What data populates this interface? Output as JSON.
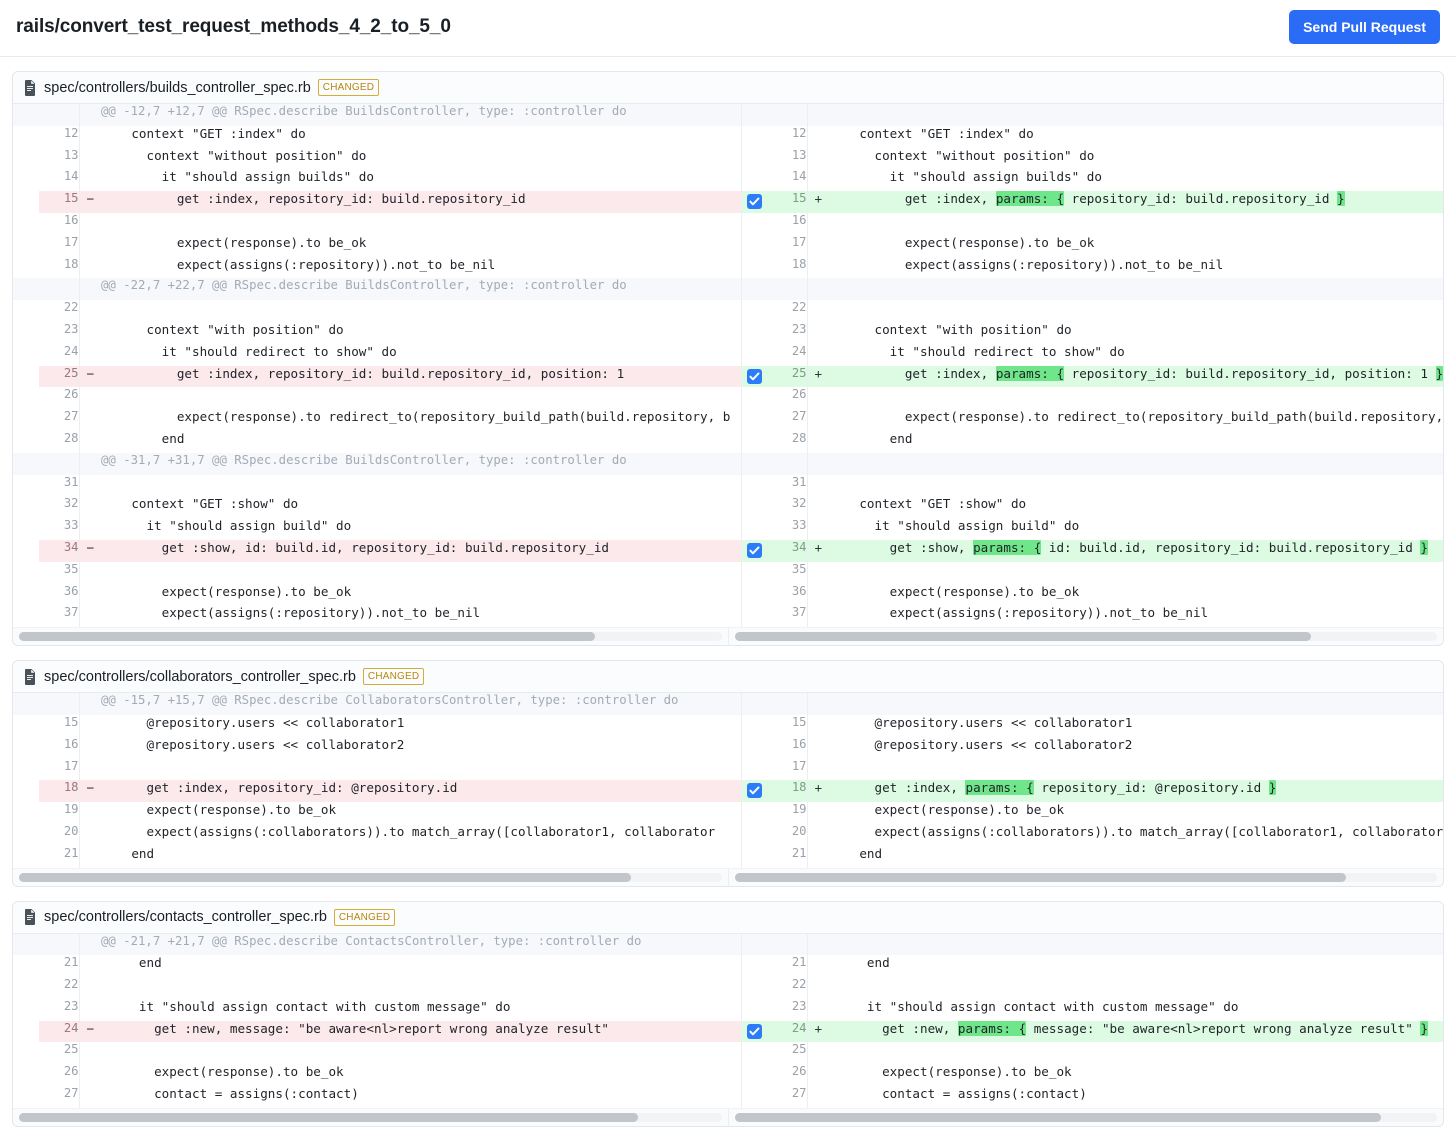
{
  "header": {
    "branch_title": "rails/convert_test_request_methods_4_2_to_5_0",
    "send_pr_label": "Send Pull Request"
  },
  "badge_label": "CHANGED",
  "files": [
    {
      "path": "spec/controllers/builds_controller_spec.rb",
      "left_scroll_pct": 82,
      "right_scroll_pct": 82,
      "rows": [
        {
          "type": "hunk",
          "left_num": "",
          "right_num": "",
          "left_text": "@@ -12,7 +12,7 @@ RSpec.describe BuildsController, type: :controller do",
          "right_text": ""
        },
        {
          "type": "ctx",
          "left_num": "12",
          "right_num": "12",
          "left_text": "    context \"GET :index\" do",
          "right_text": "    context \"GET :index\" do"
        },
        {
          "type": "ctx",
          "left_num": "13",
          "right_num": "13",
          "left_text": "      context \"without position\" do",
          "right_text": "      context \"without position\" do"
        },
        {
          "type": "ctx",
          "left_num": "14",
          "right_num": "14",
          "left_text": "        it \"should assign builds\" do",
          "right_text": "        it \"should assign builds\" do"
        },
        {
          "type": "change",
          "left_num": "15",
          "right_num": "15",
          "checked": true,
          "left_text": "          get :index, repository_id: build.repository_id",
          "right_parts": [
            {
              "t": "          get :index, ",
              "hl": false
            },
            {
              "t": "params: {",
              "hl": true
            },
            {
              "t": " repository_id: build.repository_id ",
              "hl": false
            },
            {
              "t": "}",
              "hl": true
            }
          ]
        },
        {
          "type": "ctx",
          "left_num": "16",
          "right_num": "16",
          "left_text": "",
          "right_text": ""
        },
        {
          "type": "ctx",
          "left_num": "17",
          "right_num": "17",
          "left_text": "          expect(response).to be_ok",
          "right_text": "          expect(response).to be_ok"
        },
        {
          "type": "ctx",
          "left_num": "18",
          "right_num": "18",
          "left_text": "          expect(assigns(:repository)).not_to be_nil",
          "right_text": "          expect(assigns(:repository)).not_to be_nil"
        },
        {
          "type": "hunk",
          "left_num": "",
          "right_num": "",
          "left_text": "@@ -22,7 +22,7 @@ RSpec.describe BuildsController, type: :controller do",
          "right_text": ""
        },
        {
          "type": "ctx",
          "left_num": "22",
          "right_num": "22",
          "left_text": "",
          "right_text": ""
        },
        {
          "type": "ctx",
          "left_num": "23",
          "right_num": "23",
          "left_text": "      context \"with position\" do",
          "right_text": "      context \"with position\" do"
        },
        {
          "type": "ctx",
          "left_num": "24",
          "right_num": "24",
          "left_text": "        it \"should redirect to show\" do",
          "right_text": "        it \"should redirect to show\" do"
        },
        {
          "type": "change",
          "left_num": "25",
          "right_num": "25",
          "checked": true,
          "left_text": "          get :index, repository_id: build.repository_id, position: 1",
          "right_parts": [
            {
              "t": "          get :index, ",
              "hl": false
            },
            {
              "t": "params: {",
              "hl": true
            },
            {
              "t": " repository_id: build.repository_id, position: 1 ",
              "hl": false
            },
            {
              "t": "}",
              "hl": true
            }
          ]
        },
        {
          "type": "ctx",
          "left_num": "26",
          "right_num": "26",
          "left_text": "",
          "right_text": ""
        },
        {
          "type": "ctx",
          "left_num": "27",
          "right_num": "27",
          "left_text": "          expect(response).to redirect_to(repository_build_path(build.repository, b",
          "right_text": "          expect(response).to redirect_to(repository_build_path(build.repository, b"
        },
        {
          "type": "ctx",
          "left_num": "28",
          "right_num": "28",
          "left_text": "        end",
          "right_text": "        end"
        },
        {
          "type": "hunk",
          "left_num": "",
          "right_num": "",
          "left_text": "@@ -31,7 +31,7 @@ RSpec.describe BuildsController, type: :controller do",
          "right_text": ""
        },
        {
          "type": "ctx",
          "left_num": "31",
          "right_num": "31",
          "left_text": "",
          "right_text": ""
        },
        {
          "type": "ctx",
          "left_num": "32",
          "right_num": "32",
          "left_text": "    context \"GET :show\" do",
          "right_text": "    context \"GET :show\" do"
        },
        {
          "type": "ctx",
          "left_num": "33",
          "right_num": "33",
          "left_text": "      it \"should assign build\" do",
          "right_text": "      it \"should assign build\" do"
        },
        {
          "type": "change",
          "left_num": "34",
          "right_num": "34",
          "checked": true,
          "left_text": "        get :show, id: build.id, repository_id: build.repository_id",
          "right_parts": [
            {
              "t": "        get :show, ",
              "hl": false
            },
            {
              "t": "params: {",
              "hl": true
            },
            {
              "t": " id: build.id, repository_id: build.repository_id ",
              "hl": false
            },
            {
              "t": "}",
              "hl": true
            }
          ]
        },
        {
          "type": "ctx",
          "left_num": "35",
          "right_num": "35",
          "left_text": "",
          "right_text": ""
        },
        {
          "type": "ctx",
          "left_num": "36",
          "right_num": "36",
          "left_text": "        expect(response).to be_ok",
          "right_text": "        expect(response).to be_ok"
        },
        {
          "type": "ctx",
          "left_num": "37",
          "right_num": "37",
          "left_text": "        expect(assigns(:repository)).not_to be_nil",
          "right_text": "        expect(assigns(:repository)).not_to be_nil"
        }
      ]
    },
    {
      "path": "spec/controllers/collaborators_controller_spec.rb",
      "left_scroll_pct": 87,
      "right_scroll_pct": 87,
      "rows": [
        {
          "type": "hunk",
          "left_num": "",
          "right_num": "",
          "left_text": "@@ -15,7 +15,7 @@ RSpec.describe CollaboratorsController, type: :controller do",
          "right_text": ""
        },
        {
          "type": "ctx",
          "left_num": "15",
          "right_num": "15",
          "left_text": "      @repository.users << collaborator1",
          "right_text": "      @repository.users << collaborator1"
        },
        {
          "type": "ctx",
          "left_num": "16",
          "right_num": "16",
          "left_text": "      @repository.users << collaborator2",
          "right_text": "      @repository.users << collaborator2"
        },
        {
          "type": "ctx",
          "left_num": "17",
          "right_num": "17",
          "left_text": "",
          "right_text": ""
        },
        {
          "type": "change",
          "left_num": "18",
          "right_num": "18",
          "checked": true,
          "left_text": "      get :index, repository_id: @repository.id",
          "right_parts": [
            {
              "t": "      get :index, ",
              "hl": false
            },
            {
              "t": "params: {",
              "hl": true
            },
            {
              "t": " repository_id: @repository.id ",
              "hl": false
            },
            {
              "t": "}",
              "hl": true
            }
          ]
        },
        {
          "type": "ctx",
          "left_num": "19",
          "right_num": "19",
          "left_text": "      expect(response).to be_ok",
          "right_text": "      expect(response).to be_ok"
        },
        {
          "type": "ctx",
          "left_num": "20",
          "right_num": "20",
          "left_text": "      expect(assigns(:collaborators)).to match_array([collaborator1, collaborator",
          "right_text": "      expect(assigns(:collaborators)).to match_array([collaborator1, collaborator"
        },
        {
          "type": "ctx",
          "left_num": "21",
          "right_num": "21",
          "left_text": "    end",
          "right_text": "    end"
        }
      ]
    },
    {
      "path": "spec/controllers/contacts_controller_spec.rb",
      "left_scroll_pct": 88,
      "right_scroll_pct": 92,
      "rows": [
        {
          "type": "hunk",
          "left_num": "",
          "right_num": "",
          "left_text": "@@ -21,7 +21,7 @@ RSpec.describe ContactsController, type: :controller do",
          "right_text": ""
        },
        {
          "type": "ctx",
          "left_num": "21",
          "right_num": "21",
          "left_text": "     end",
          "right_text": "     end"
        },
        {
          "type": "ctx",
          "left_num": "22",
          "right_num": "22",
          "left_text": "",
          "right_text": ""
        },
        {
          "type": "ctx",
          "left_num": "23",
          "right_num": "23",
          "left_text": "     it \"should assign contact with custom message\" do",
          "right_text": "     it \"should assign contact with custom message\" do"
        },
        {
          "type": "change",
          "left_num": "24",
          "right_num": "24",
          "checked": true,
          "left_text": "       get :new, message: \"be aware<nl>report wrong analyze result\"",
          "right_parts": [
            {
              "t": "       get :new, ",
              "hl": false
            },
            {
              "t": "params: {",
              "hl": true
            },
            {
              "t": " message: \"be aware<nl>report wrong analyze result\" ",
              "hl": false
            },
            {
              "t": "}",
              "hl": true
            }
          ]
        },
        {
          "type": "ctx",
          "left_num": "25",
          "right_num": "25",
          "left_text": "",
          "right_text": ""
        },
        {
          "type": "ctx",
          "left_num": "26",
          "right_num": "26",
          "left_text": "       expect(response).to be_ok",
          "right_text": "       expect(response).to be_ok"
        },
        {
          "type": "ctx",
          "left_num": "27",
          "right_num": "27",
          "left_text": "       contact = assigns(:contact)",
          "right_text": "       contact = assigns(:contact)"
        }
      ]
    }
  ],
  "colors": {
    "accent_blue": "#2b6cf6",
    "add_bg": "#ddfbe2",
    "add_word": "#6fe68a",
    "del_bg": "#fbe9ec",
    "badge_amber": "#b8860b"
  }
}
